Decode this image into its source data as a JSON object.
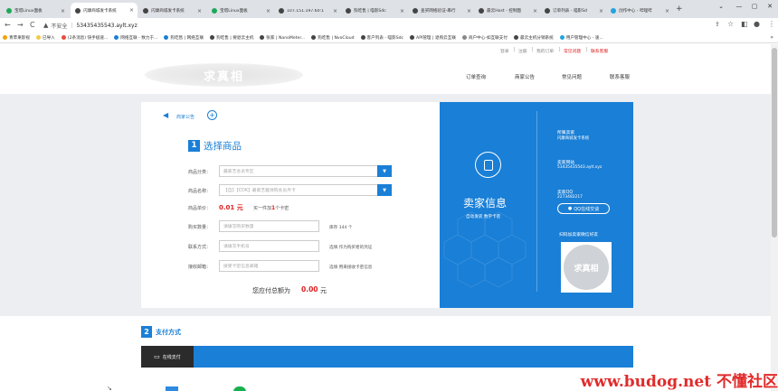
{
  "browser": {
    "tabs": [
      {
        "title": "宝塔Linux面板",
        "color": "#1ea85a"
      },
      {
        "title": "闪康商城发卡系统",
        "color": "#444",
        "active": true
      },
      {
        "title": "闪康商城发卡系统",
        "color": "#444"
      },
      {
        "title": "宝塔Linux面板",
        "color": "#1ea85a"
      },
      {
        "title": "107.151.197.60:1",
        "color": "#444"
      },
      {
        "title": "狗吃售 | 喵影Sdc",
        "color": "#444"
      },
      {
        "title": "查买网络验证-串行",
        "color": "#444"
      },
      {
        "title": "最云Host - 控制面",
        "color": "#444"
      },
      {
        "title": "订单列表 - 喵影Sd",
        "color": "#444"
      },
      {
        "title": "创作中心 - 哔哩哔",
        "color": "#23a3dd"
      }
    ],
    "new_tab": "+",
    "address": {
      "security": "不安全",
      "url": "53435435543.aylt.xyz"
    },
    "bookmarks": [
      {
        "label": "青苹果影视",
        "color": "#f4a300"
      },
      {
        "label": "已导入",
        "color": "#f2c94c"
      },
      {
        "label": "(2条消息) 快手极速...",
        "color": "#e74c3c"
      },
      {
        "label": "网络互联 - 致力于...",
        "color": "#1a7fd6"
      },
      {
        "label": "狗吃售 | 网络互联",
        "color": "#1a7fd6"
      },
      {
        "label": "狗吃售 | 要退云主机",
        "color": "#444"
      },
      {
        "label": "张家 | NanoMeter...",
        "color": "#444"
      },
      {
        "label": "狗吃售 | NvoCloud",
        "color": "#444"
      },
      {
        "label": "客户列表 - 喵影Sdc",
        "color": "#444"
      },
      {
        "label": "API管理 | 退购云互联",
        "color": "#444"
      },
      {
        "label": "商户中心-如互联支付",
        "color": "#888"
      },
      {
        "label": "最云主机分销系统",
        "color": "#444"
      },
      {
        "label": "用户管理中心 - 速...",
        "color": "#23a3dd"
      }
    ]
  },
  "top_links": {
    "login": "登录",
    "sep1": "|",
    "register": "注册",
    "sep2": "|",
    "orders": "我的订单",
    "sep3": "|",
    "faq": "常见问题",
    "sep4": "|",
    "contact": "联系客服"
  },
  "logo_text": "求真相",
  "main_nav": [
    "订单查询",
    "商家公告",
    "常见问题",
    "联系客服"
  ],
  "notice": {
    "label": "商家公告",
    "plus": "+"
  },
  "step1": {
    "num": "1",
    "title": "选择商品"
  },
  "form": {
    "category_label": "商品分类：",
    "category_value": "最家艺会员专区",
    "product_label": "商品名称：",
    "product_value": "【自】【CDK】最家艺趣清购会员月卡",
    "price_label": "商品单价：",
    "price_value": "0.01 元",
    "bulk_prefix": "买一件加",
    "bulk_num": "1",
    "bulk_suffix": "个卡密",
    "qty_label": "购买数量：",
    "qty_placeholder": "请填写购买数量",
    "stock_text": "库存 344 个",
    "contact_label": "联系方式：",
    "contact_placeholder": "请填写手机号",
    "contact_note": "选填 作为购买者的凭证",
    "email_label": "接收邮箱：",
    "email_placeholder": "接受卡密信息邮箱",
    "email_note": "选填 用来接收卡密信息",
    "total_prefix": "您应付总额为",
    "total_value": "0.00",
    "total_unit": "元"
  },
  "seller": {
    "title": "卖家信息",
    "subtitle": "自动发货  数字卡密",
    "shop_label": "所属卖家",
    "shop_value": "闪康商城发卡系统",
    "site_label": "卖家网站",
    "site_value": "53435435543.aylt.xyz",
    "qq_label": "卖家QQ",
    "qq_value": "2273482217",
    "qq_button": "QQ在线交谈",
    "wechat_label": "扫码加卖家微信好友",
    "qr_text": "求真相"
  },
  "step2": {
    "num": "2",
    "title": "支付方式"
  },
  "payment": {
    "option": "在线支付"
  },
  "watermark": "www.budog.net 不懂社区",
  "colors": {
    "accent": "#1a7fd6",
    "price": "#e02020",
    "tabbar": "#dee1e6"
  }
}
